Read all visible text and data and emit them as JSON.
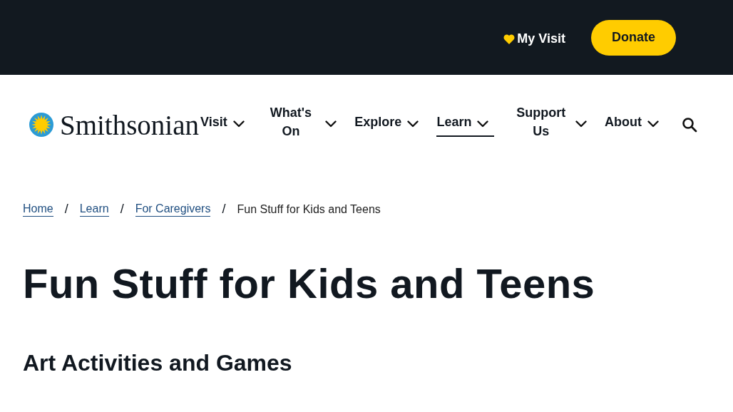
{
  "top_bar": {
    "my_visit": "My Visit",
    "donate": "Donate"
  },
  "logo": {
    "text": "Smithsonian"
  },
  "nav": [
    {
      "label": "Visit",
      "selected": false
    },
    {
      "label": "What's On",
      "selected": false
    },
    {
      "label": "Explore",
      "selected": false
    },
    {
      "label": "Learn",
      "selected": true
    },
    {
      "label": "Support Us",
      "selected": false
    },
    {
      "label": "About",
      "selected": false
    }
  ],
  "breadcrumb": [
    {
      "kind": "link",
      "label": "Home"
    },
    {
      "kind": "separator",
      "label": "/"
    },
    {
      "kind": "link",
      "label": "Learn"
    },
    {
      "kind": "separator",
      "label": "/"
    },
    {
      "kind": "link",
      "label": "For Caregivers"
    },
    {
      "kind": "separator",
      "label": "/"
    },
    {
      "kind": "current",
      "label": "Fun Stuff for Kids and Teens"
    }
  ],
  "title": "Fun Stuff for Kids and Teens",
  "section_heading": "Art Activities and Games"
}
